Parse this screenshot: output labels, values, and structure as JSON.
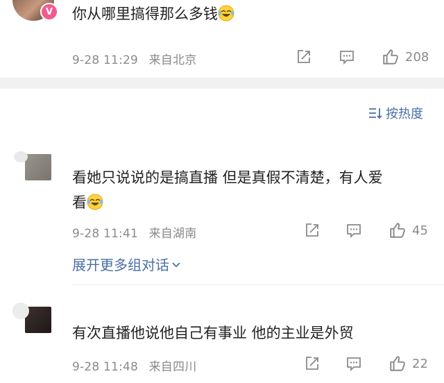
{
  "colors": {
    "accent_link": "#4a6fa5",
    "meta_gray": "#8a8a8a",
    "band_gray": "#f1f1f1",
    "badge_pink": "#f15a8f"
  },
  "comments": [
    {
      "text": "你从哪里搞得那么多钱",
      "emoji": "laughing-crying-emoji",
      "date": "9-28 11:29",
      "location": "来自北京",
      "likes": "208",
      "badge": "V"
    },
    {
      "text_line1": "看她只说说的是搞直播 但是真假不清楚，有人爱",
      "text_line2": "看",
      "emoji": "laughing-crying-emoji",
      "date": "9-28 11:41",
      "location": "来自湖南",
      "likes": "45",
      "expand_label": "展开更多组对话"
    },
    {
      "text": "有次直播他说他自己有事业 他的主业是外贸",
      "date": "9-28 11:48",
      "location": "来自四川",
      "likes": "22"
    }
  ],
  "sort": {
    "label": "按热度",
    "icon": "sort-lines-icon"
  },
  "icons": {
    "share": "share-icon",
    "comment": "comment-icon",
    "like": "thumbs-up-icon",
    "expand": "chevron-down-icon"
  }
}
